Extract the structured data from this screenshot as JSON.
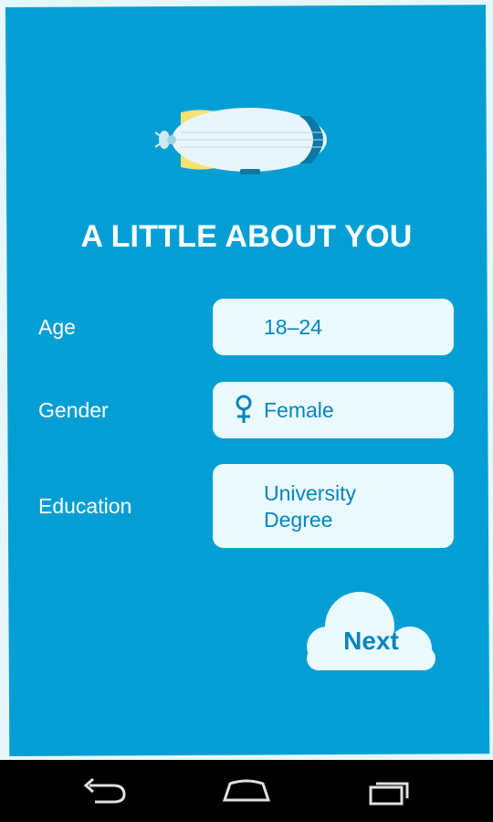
{
  "title": "A LITTLE ABOUT YOU",
  "fields": [
    {
      "label": "Age",
      "value": "18–24",
      "icon": ""
    },
    {
      "label": "Gender",
      "value": "Female",
      "icon": "female-symbol-icon"
    },
    {
      "label": "Education",
      "value_line1": "University",
      "value_line2": "Degree",
      "icon": ""
    }
  ],
  "next_button": {
    "label": "Next"
  },
  "navbar": {
    "back_icon": "back-icon",
    "home_icon": "home-icon",
    "recents_icon": "recent-apps-icon"
  },
  "colors": {
    "background": "#039fd4",
    "field": "#eafaff",
    "field_text": "#0585bd",
    "navbar": "#000000"
  }
}
